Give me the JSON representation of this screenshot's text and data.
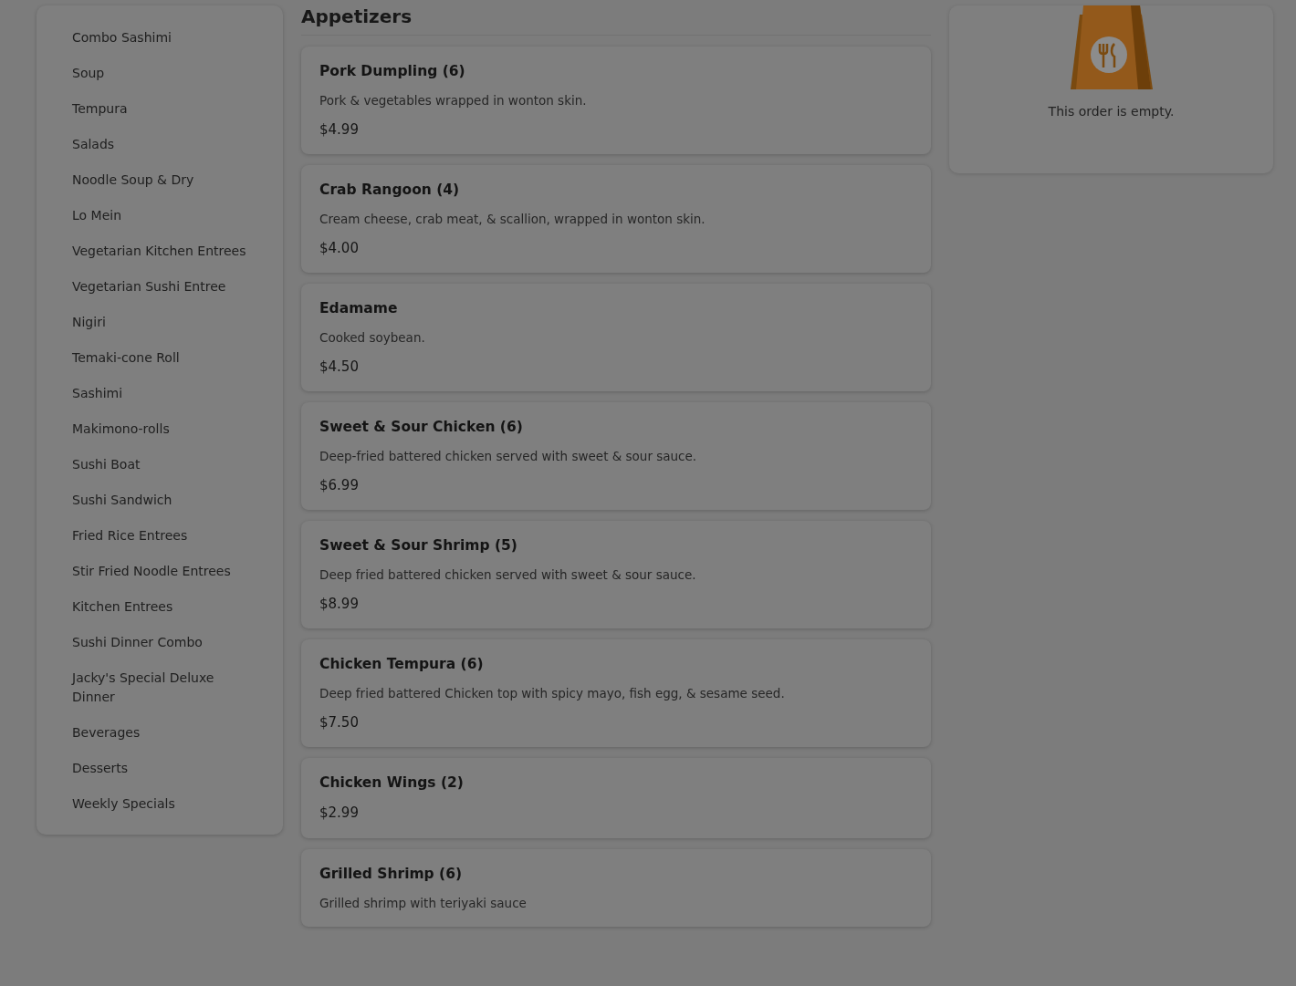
{
  "categories": [
    {
      "label": "Combo Sashimi"
    },
    {
      "label": "Soup"
    },
    {
      "label": "Tempura"
    },
    {
      "label": "Salads"
    },
    {
      "label": "Noodle Soup & Dry"
    },
    {
      "label": "Lo Mein"
    },
    {
      "label": "Vegetarian Kitchen Entrees"
    },
    {
      "label": "Vegetarian Sushi Entree"
    },
    {
      "label": "Nigiri"
    },
    {
      "label": "Temaki-cone Roll"
    },
    {
      "label": "Sashimi"
    },
    {
      "label": "Makimono-rolls"
    },
    {
      "label": "Sushi Boat"
    },
    {
      "label": "Sushi Sandwich"
    },
    {
      "label": "Fried Rice Entrees"
    },
    {
      "label": "Stir Fried Noodle Entrees"
    },
    {
      "label": "Kitchen Entrees"
    },
    {
      "label": "Sushi Dinner Combo"
    },
    {
      "label": "Jacky's Special Deluxe Dinner"
    },
    {
      "label": "Beverages"
    },
    {
      "label": "Desserts"
    },
    {
      "label": "Weekly Specials"
    }
  ],
  "section": {
    "title": "Appetizers",
    "items": [
      {
        "name": "Pork Dumpling (6)",
        "description": "Pork & vegetables wrapped in wonton skin.",
        "price": "$4.99"
      },
      {
        "name": "Crab Rangoon (4)",
        "description": "Cream cheese, crab meat, & scallion, wrapped in wonton skin.",
        "price": "$4.00"
      },
      {
        "name": "Edamame",
        "description": "Cooked soybean.",
        "price": "$4.50"
      },
      {
        "name": "Sweet & Sour Chicken (6)",
        "description": "Deep-fried battered chicken served with sweet & sour sauce.",
        "price": "$6.99"
      },
      {
        "name": "Sweet & Sour Shrimp (5)",
        "description": "Deep fried battered chicken served with sweet & sour sauce.",
        "price": "$8.99"
      },
      {
        "name": "Chicken Tempura (6)",
        "description": "Deep fried battered Chicken top with spicy mayo, fish egg, & sesame seed.",
        "price": "$7.50"
      },
      {
        "name": "Chicken Wings (2)",
        "price": "$2.99"
      },
      {
        "name": "Grilled Shrimp (6)",
        "description": "Grilled shrimp with teriyaki sauce"
      }
    ]
  },
  "order": {
    "empty_message": "This order is empty."
  }
}
